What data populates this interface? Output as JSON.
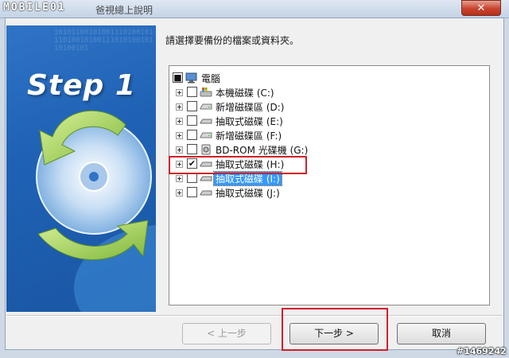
{
  "window": {
    "brand": "MOBILE01",
    "title": "爸視總上說明",
    "close_glyph": "✕"
  },
  "art": {
    "step_label": "Step 1",
    "binary_text": "101011001010011101001011101001010011101010010110100101"
  },
  "instruction": "請選擇要備份的檔案或資料夾。",
  "tree": {
    "root": {
      "label": "電腦",
      "icon": "computer-icon",
      "checked": "partial"
    },
    "items": [
      {
        "label": "本機磁碟 (C:)",
        "icon": "windows-drive-icon",
        "checked": false
      },
      {
        "label": "新增磁碟區 (D:)",
        "icon": "hard-drive-icon",
        "checked": false
      },
      {
        "label": "抽取式磁碟 (E:)",
        "icon": "removable-drive-icon",
        "checked": false
      },
      {
        "label": "新增磁碟區 (F:)",
        "icon": "hard-drive-icon",
        "checked": false
      },
      {
        "label": "BD-ROM 光碟機 (G:)",
        "icon": "optical-drive-icon",
        "checked": false
      },
      {
        "label": "抽取式磁碟 (H:)",
        "icon": "removable-drive-icon",
        "checked": true
      },
      {
        "label": "抽取式磁碟 (I:)",
        "icon": "removable-drive-icon",
        "checked": false,
        "selected": true
      },
      {
        "label": "抽取式磁碟 (J:)",
        "icon": "removable-drive-icon",
        "checked": false
      }
    ]
  },
  "buttons": {
    "back": "< 上一步",
    "next": "下一步 >",
    "cancel": "取消"
  },
  "watermark": "#1469242",
  "colors": {
    "highlight": "#d0202a",
    "selection": "#3399ff"
  }
}
